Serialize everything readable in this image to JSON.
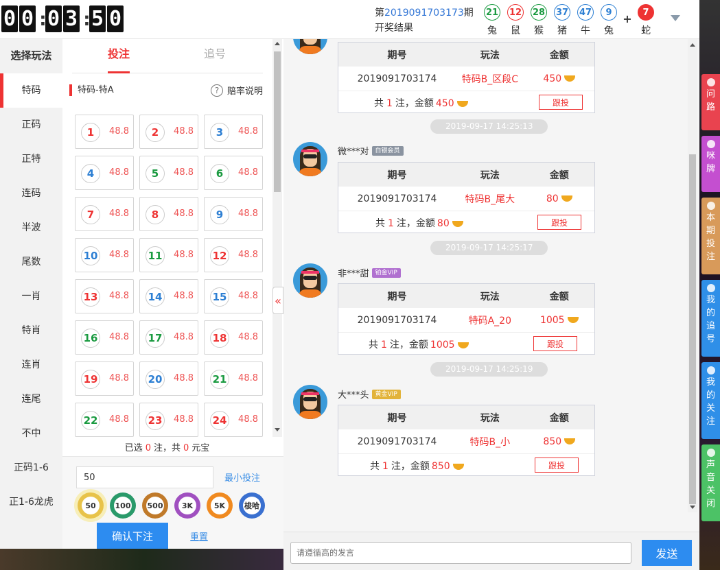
{
  "timer": {
    "digits": [
      "0",
      "0",
      "0",
      "3",
      "5",
      "0"
    ]
  },
  "period": {
    "prefix": "第",
    "number": "2019091703173",
    "suffix": "期",
    "line2": "开奖结果"
  },
  "draw_results": [
    {
      "num": "21",
      "zodiac": "兔",
      "color": "green"
    },
    {
      "num": "12",
      "zodiac": "鼠",
      "color": "red"
    },
    {
      "num": "28",
      "zodiac": "猴",
      "color": "green"
    },
    {
      "num": "37",
      "zodiac": "猪",
      "color": "blue"
    },
    {
      "num": "47",
      "zodiac": "牛",
      "color": "blue"
    },
    {
      "num": "9",
      "zodiac": "兔",
      "color": "blue"
    }
  ],
  "draw_plus": "+",
  "special_result": {
    "num": "7",
    "zodiac": "蛇"
  },
  "nav": {
    "title": "选择玩法",
    "items": [
      "特码",
      "正码",
      "正特",
      "连码",
      "半波",
      "尾数",
      "一肖",
      "特肖",
      "连肖",
      "连尾",
      "不中",
      "正码1-6",
      "正1-6龙虎"
    ]
  },
  "tabs": {
    "bet": "投注",
    "chase": "追号"
  },
  "subtitle": "特码-特A",
  "odds_help": "赔率说明",
  "grid": [
    {
      "num": "1",
      "color": "red",
      "odds": "48.8"
    },
    {
      "num": "2",
      "color": "red",
      "odds": "48.8"
    },
    {
      "num": "3",
      "color": "blue",
      "odds": "48.8"
    },
    {
      "num": "4",
      "color": "blue",
      "odds": "48.8"
    },
    {
      "num": "5",
      "color": "green",
      "odds": "48.8"
    },
    {
      "num": "6",
      "color": "green",
      "odds": "48.8"
    },
    {
      "num": "7",
      "color": "red",
      "odds": "48.8"
    },
    {
      "num": "8",
      "color": "red",
      "odds": "48.8"
    },
    {
      "num": "9",
      "color": "blue",
      "odds": "48.8"
    },
    {
      "num": "10",
      "color": "blue",
      "odds": "48.8"
    },
    {
      "num": "11",
      "color": "green",
      "odds": "48.8"
    },
    {
      "num": "12",
      "color": "red",
      "odds": "48.8"
    },
    {
      "num": "13",
      "color": "red",
      "odds": "48.8"
    },
    {
      "num": "14",
      "color": "blue",
      "odds": "48.8"
    },
    {
      "num": "15",
      "color": "blue",
      "odds": "48.8"
    },
    {
      "num": "16",
      "color": "green",
      "odds": "48.8"
    },
    {
      "num": "17",
      "color": "green",
      "odds": "48.8"
    },
    {
      "num": "18",
      "color": "red",
      "odds": "48.8"
    },
    {
      "num": "19",
      "color": "red",
      "odds": "48.8"
    },
    {
      "num": "20",
      "color": "blue",
      "odds": "48.8"
    },
    {
      "num": "21",
      "color": "green",
      "odds": "48.8"
    },
    {
      "num": "22",
      "color": "green",
      "odds": "48.8"
    },
    {
      "num": "23",
      "color": "red",
      "odds": "48.8"
    },
    {
      "num": "24",
      "color": "red",
      "odds": "48.8"
    }
  ],
  "summary": {
    "prefix": "已选",
    "count": "0",
    "mid": "注，共",
    "amount": "0",
    "suffix": "元宝"
  },
  "amount_input": {
    "value": "50"
  },
  "min_bet": "最小投注",
  "chips": [
    {
      "label": "50",
      "color": "#e8c34a",
      "selected": true
    },
    {
      "label": "100",
      "color": "#2a9a6a"
    },
    {
      "label": "500",
      "color": "#c07a2a"
    },
    {
      "label": "3K",
      "color": "#a050c0"
    },
    {
      "label": "5K",
      "color": "#f08a20"
    },
    {
      "label": "梭哈",
      "color": "#3a70d0"
    }
  ],
  "confirm": "确认下注",
  "reset": "重置",
  "collapse_icon": "«",
  "card_headers": {
    "period": "期号",
    "play": "玩法",
    "amount": "金额"
  },
  "follow_label": "跟投",
  "messages": [
    {
      "user": "",
      "badge": "",
      "period": "2019091703174",
      "play": "特码B_区段C",
      "amount": "450",
      "foot_pre": "共",
      "foot_count": "1",
      "foot_mid": "注，金额",
      "foot_amount": "450"
    },
    {
      "time": "2019-09-17 14:25:13",
      "user": "微***对",
      "badge": "白银会员",
      "period": "2019091703174",
      "play": "特码B_尾大",
      "amount": "80",
      "foot_pre": "共",
      "foot_count": "1",
      "foot_mid": "注，金额",
      "foot_amount": "80"
    },
    {
      "time": "2019-09-17 14:25:17",
      "user": "非***甜",
      "badge": "铂金VIP",
      "period": "2019091703174",
      "play": "特码A_20",
      "amount": "1005",
      "foot_pre": "共",
      "foot_count": "1",
      "foot_mid": "注，金额",
      "foot_amount": "1005"
    },
    {
      "time": "2019-09-17 14:25:19",
      "user": "大***头",
      "badge": "黄金VIP",
      "period": "2019091703174",
      "play": "特码B_小",
      "amount": "850",
      "foot_pre": "共",
      "foot_count": "1",
      "foot_mid": "注，金额",
      "foot_amount": "850"
    }
  ],
  "chat_input": {
    "placeholder": "请遵循高的发言"
  },
  "send": "发送",
  "side_buttons": [
    {
      "label": "问路",
      "color": "#e9434f",
      "icon": "chat-bubble-icon"
    },
    {
      "label": "咪牌",
      "color": "#c44fd0",
      "icon": "hand-pointer-icon"
    },
    {
      "label": "本期投注",
      "color": "#d89a5a",
      "icon": "coin-icon"
    },
    {
      "label": "我的追号",
      "color": "#2f8fe8",
      "icon": "document-icon"
    },
    {
      "label": "我的关注",
      "color": "#2f8fe8",
      "icon": "bookmark-icon"
    },
    {
      "label": "声音关闭",
      "color": "#4cc266",
      "icon": "speaker-icon"
    }
  ]
}
